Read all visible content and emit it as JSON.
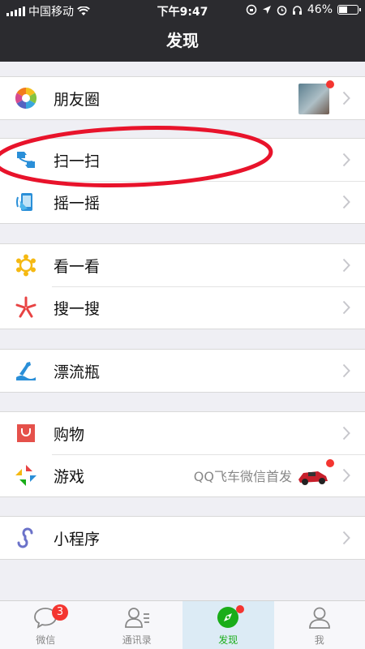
{
  "status_bar": {
    "carrier": "中国移动",
    "time": "下午9:47",
    "battery_percent": "46%",
    "battery_level": 0.46
  },
  "nav": {
    "title": "发现"
  },
  "menu": {
    "moments": {
      "label": "朋友圈",
      "icon": "moments-icon"
    },
    "scan": {
      "label": "扫一扫",
      "icon": "scan-icon"
    },
    "shake": {
      "label": "摇一摇",
      "icon": "shake-icon"
    },
    "top_stories": {
      "label": "看一看",
      "icon": "top-stories-icon"
    },
    "search": {
      "label": "搜一搜",
      "icon": "search-icon"
    },
    "drift_bottle": {
      "label": "漂流瓶",
      "icon": "drift-bottle-icon"
    },
    "shopping": {
      "label": "购物",
      "icon": "shopping-icon"
    },
    "games": {
      "label": "游戏",
      "icon": "games-icon",
      "promo_text": "QQ飞车微信首发"
    },
    "mini_programs": {
      "label": "小程序",
      "icon": "mini-programs-icon"
    }
  },
  "tabs": [
    {
      "label": "微信",
      "badge": "3",
      "icon": "chats-icon"
    },
    {
      "label": "通讯录",
      "icon": "contacts-icon"
    },
    {
      "label": "发现",
      "icon": "discover-compass-icon"
    },
    {
      "label": "我",
      "icon": "me-icon"
    }
  ],
  "colors": {
    "accent": "#1aad19",
    "bar": "#2b2b2f",
    "badge": "#f43530",
    "annotation": "#e8132b"
  }
}
